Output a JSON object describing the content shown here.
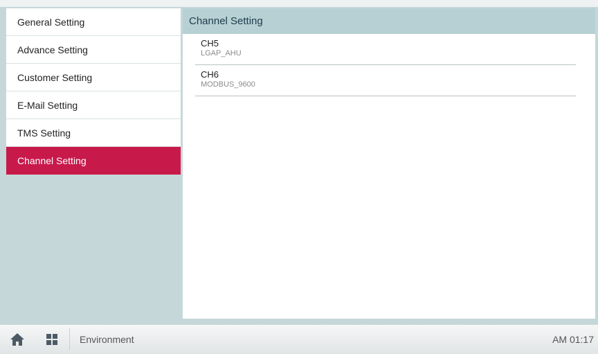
{
  "sidebar": {
    "items": [
      {
        "label": "General Setting"
      },
      {
        "label": "Advance Setting"
      },
      {
        "label": "Customer Setting"
      },
      {
        "label": "E-Mail Setting"
      },
      {
        "label": "TMS Setting"
      },
      {
        "label": "Channel Setting",
        "active": true
      }
    ]
  },
  "main": {
    "title": "Channel Setting",
    "channels": [
      {
        "name": "CH5",
        "protocol": "LGAP_AHU"
      },
      {
        "name": "CH6",
        "protocol": "MODBUS_9600"
      }
    ]
  },
  "bottombar": {
    "home_icon": "home-icon",
    "apps_icon": "grid-icon",
    "label": "Environment",
    "time": "AM 01:17"
  },
  "colors": {
    "accent": "#c8194b",
    "header": "#b7d0d4",
    "background": "#c6d7d9"
  }
}
